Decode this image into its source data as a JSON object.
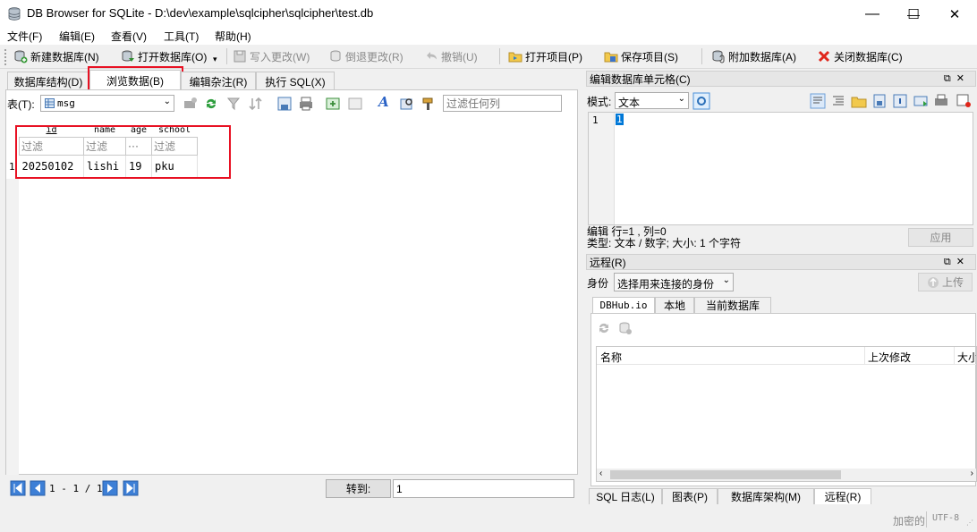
{
  "window": {
    "title": "DB Browser for SQLite - D:\\dev\\example\\sqlcipher\\sqlcipher\\test.db",
    "minimize": "—",
    "maximize": "☐",
    "close": "✕"
  },
  "menu": [
    "文件(F)",
    "编辑(E)",
    "查看(V)",
    "工具(T)",
    "帮助(H)"
  ],
  "toolbar": {
    "new_db": "新建数据库(N)",
    "open_db": "打开数据库(O)",
    "write_changes": "写入更改(W)",
    "revert_changes": "倒退更改(R)",
    "undo": "撤销(U)",
    "open_project": "打开项目(P)",
    "save_project": "保存项目(S)",
    "attach_db": "附加数据库(A)",
    "close_db": "关闭数据库(C)"
  },
  "main_tabs": [
    "数据库结构(D)",
    "浏览数据(B)",
    "编辑杂注(R)",
    "执行 SQL(X)"
  ],
  "browse": {
    "table_label": "表(T):",
    "table_value": "msg",
    "filter_placeholder": "过滤任何列",
    "columns": [
      "id",
      "name",
      "age",
      "school"
    ],
    "column_filters": [
      "过滤",
      "过滤",
      "···",
      "过滤"
    ],
    "row_numbers": [
      "1"
    ],
    "rows": [
      [
        "20250102",
        "lishi",
        "19",
        "pku"
      ]
    ],
    "pager_text": "1 - 1 / 1",
    "goto_label": "转到:",
    "goto_value": "1"
  },
  "edit_cell": {
    "title": "编辑数据库单元格(C)",
    "mode_label": "模式:",
    "mode_value": "文本",
    "line_number": "1",
    "cell_value": "1",
    "status_line1": "编辑 行=1 , 列=0",
    "status_line2": "类型: 文本 / 数字; 大小: 1 个字符",
    "apply_button": "应用"
  },
  "remote": {
    "title": "远程(R)",
    "identity_label": "身份",
    "identity_value": "选择用来连接的身份",
    "upload_button": "上传",
    "tabs": [
      "DBHub.io",
      "本地",
      "当前数据库"
    ],
    "columns": [
      "名称",
      "上次修改",
      "大小"
    ]
  },
  "bottom_tabs": [
    "SQL 日志(L)",
    "图表(P)",
    "数据库架构(M)",
    "远程(R)"
  ],
  "status": {
    "encrypted": "加密的",
    "encoding": "UTF-8"
  },
  "colors": {
    "highlight_red": "#e81123",
    "selection_blue": "#0078d7",
    "panel_title_bg": "#e6e6e6"
  }
}
